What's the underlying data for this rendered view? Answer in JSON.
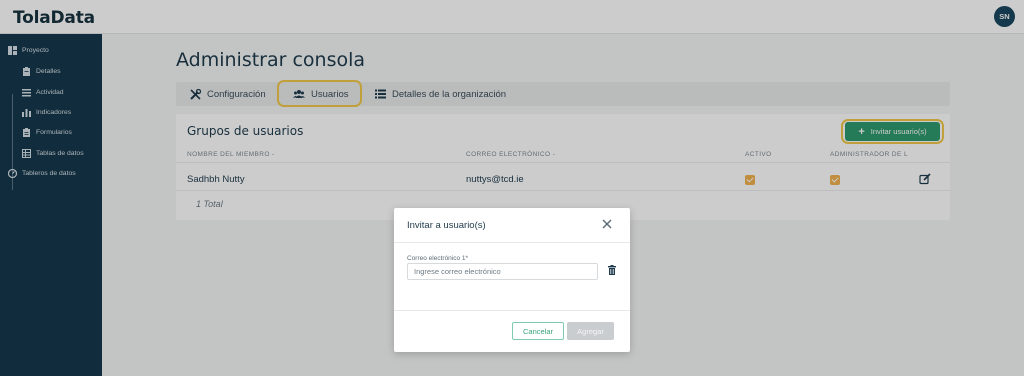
{
  "app": {
    "logo": "TolaData",
    "user_initials": "SN"
  },
  "sidebar": {
    "items": [
      {
        "label": "Proyecto",
        "icon": "grid-icon"
      },
      {
        "label": "Detalles",
        "icon": "clipboard-icon"
      },
      {
        "label": "Actividad",
        "icon": "list-icon"
      },
      {
        "label": "Indicadores",
        "icon": "bar-chart-icon"
      },
      {
        "label": "Formularios",
        "icon": "form-icon"
      },
      {
        "label": "Tablas de datos",
        "icon": "table-icon"
      },
      {
        "label": "Tableros de datos",
        "icon": "dashboard-icon"
      }
    ]
  },
  "main": {
    "title": "Administrar consola",
    "tabs": [
      {
        "label": "Configuración",
        "icon": "tools-icon"
      },
      {
        "label": "Usuarios",
        "icon": "users-icon",
        "active": true
      },
      {
        "label": "Detalles de la organización",
        "icon": "list-icon"
      }
    ],
    "card": {
      "title": "Grupos de usuarios",
      "invite_button": "Invitar usuario(s)",
      "columns": [
        "NOMBRE DEL MIEMBRO -",
        "CORREO ELECTRÓNICO -",
        "ACTIVO",
        "ADMINISTRADOR DE L"
      ],
      "rows": [
        {
          "name": "Sadhbh Nutty",
          "email": "nuttys@tcd.ie",
          "active": true,
          "admin": true
        }
      ],
      "total": "1 Total"
    }
  },
  "modal": {
    "title": "Invitar a usuario(s)",
    "field_label": "Correo electrónico 1*",
    "field_placeholder": "Ingrese correo electrónico",
    "field_value": "",
    "cancel_label": "Cancelar",
    "add_label": "Agregar"
  },
  "colors": {
    "sidebar_bg": "#16384b",
    "primary_green": "#2f9a6d",
    "checkbox": "#f0b24e",
    "highlight": "#f2c94c"
  }
}
